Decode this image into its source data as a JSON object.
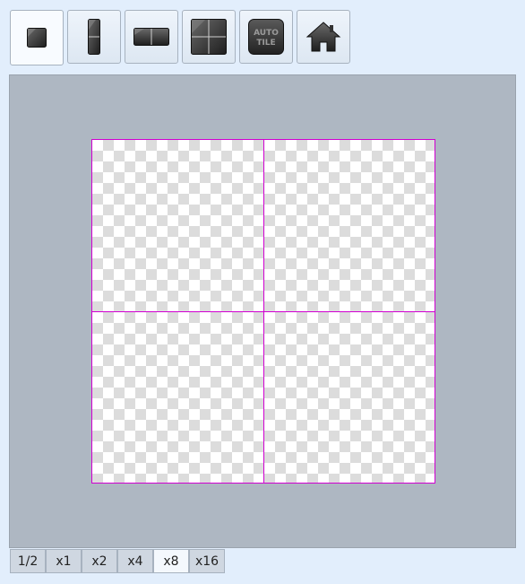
{
  "toolbar": {
    "buttons": [
      {
        "icon": "single-tile-icon",
        "active": true
      },
      {
        "icon": "vertical-tiles-icon",
        "active": false
      },
      {
        "icon": "horizontal-tiles-icon",
        "active": false
      },
      {
        "icon": "grid-tiles-icon",
        "active": false
      },
      {
        "icon": "autotile-icon",
        "label_line1": "AUTO",
        "label_line2": "TILE",
        "active": false
      },
      {
        "icon": "home-icon",
        "active": false
      }
    ]
  },
  "canvas": {
    "grid_color": "#d100d1",
    "background_color": "#aeb7c2"
  },
  "zoom": {
    "options": [
      "1/2",
      "x1",
      "x2",
      "x4",
      "x8",
      "x16"
    ],
    "selected": "x8"
  }
}
